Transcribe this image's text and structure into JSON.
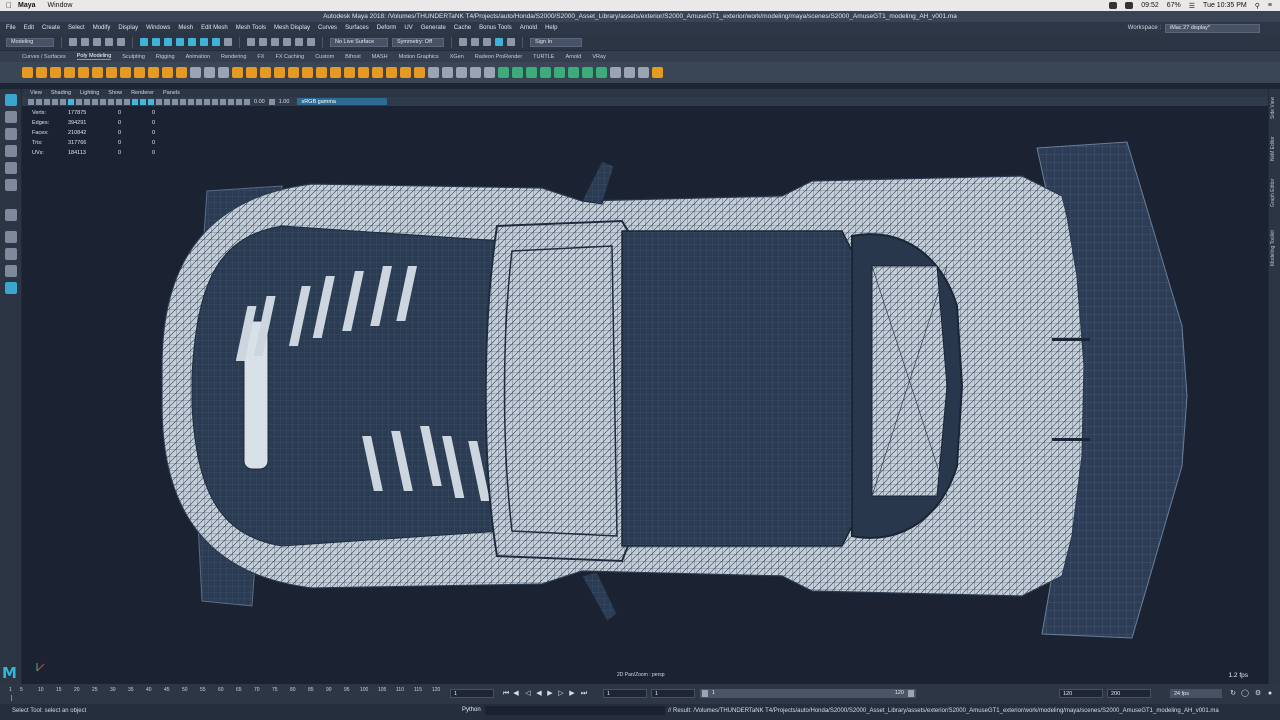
{
  "mac_menubar": {
    "app": "Maya",
    "menus": [
      "Window"
    ],
    "battery": "67%",
    "clock": "Tue 10:35 PM",
    "time_small": "09:52"
  },
  "window": {
    "title": "Autodesk Maya 2018: /Volumes/THUNDERTaNK T4/Projects/auto/Honda/S2000/S2000_Asset_Library/assets/exterior/S2000_AmuseGT1_exterior/work/modeling/maya/scenes/S2000_AmuseGT1_modeling_AH_v001.ma"
  },
  "main_menu": {
    "items": [
      "File",
      "Edit",
      "Create",
      "Select",
      "Modify",
      "Display",
      "Windows",
      "Mesh",
      "Edit Mesh",
      "Mesh Tools",
      "Mesh Display",
      "Curves",
      "Surfaces",
      "Deform",
      "UV",
      "Generate",
      "Cache",
      "Bonus Tools",
      "Arnold",
      "Help"
    ],
    "workspace_label": "Workspace :",
    "workspace_value": "iMac 27 display*"
  },
  "status_line": {
    "mode": "Modeling",
    "live_surface": "No Live Surface",
    "symmetry": "Symmetry: Off",
    "sign_in": "Sign In"
  },
  "shelf_tabs": [
    "Curves / Surfaces",
    "Poly Modeling",
    "Sculpting",
    "Rigging",
    "Animation",
    "Rendering",
    "FX",
    "FX Caching",
    "Custom",
    "Bifrost",
    "MASH",
    "Motion Graphics",
    "XGen",
    "Radeon ProRender",
    "TURTLE",
    "Arnold",
    "VRay"
  ],
  "active_shelf": "Poly Modeling",
  "panel_menu": [
    "View",
    "Shading",
    "Lighting",
    "Show",
    "Renderer",
    "Panels"
  ],
  "panel_toolbar": {
    "exposure": "0.00",
    "gamma": "1.00",
    "color_space": "sRGB gamma"
  },
  "hud": {
    "rows": [
      {
        "label": "Verts:",
        "value": "177875",
        "sel": "0",
        "comp": "0"
      },
      {
        "label": "Edges:",
        "value": "394291",
        "sel": "0",
        "comp": "0"
      },
      {
        "label": "Faces:",
        "value": "210842",
        "sel": "0",
        "comp": "0"
      },
      {
        "label": "Tris:",
        "value": "317766",
        "sel": "0",
        "comp": "0"
      },
      {
        "label": "UVs:",
        "value": "184113",
        "sel": "0",
        "comp": "0"
      }
    ],
    "camera": "2D Pan/Zoom : persp",
    "fps": "1.2 fps"
  },
  "side_tabs": [
    "Side View",
    "NxM Editor",
    "Graph Editor",
    "Modeling Toolkit"
  ],
  "time_slider": {
    "ticks": [
      "1",
      "5",
      "10",
      "15",
      "20",
      "25",
      "30",
      "35",
      "40",
      "45",
      "50",
      "55",
      "60",
      "65",
      "70",
      "75",
      "80",
      "85",
      "90",
      "95",
      "100",
      "105",
      "110",
      "115",
      "120"
    ],
    "current_frame": "1",
    "range_start": "1",
    "range_start2": "1",
    "range_inner_start": "1",
    "range_inner_end": "120",
    "end1": "120",
    "end2": "200",
    "fps_setting": "24 fps"
  },
  "command_line": {
    "help": "Select Tool: select an object",
    "language": "Python",
    "result": "// Result: /Volumes/THUNDERTaNK T4/Projects/auto/Honda/S2000/S2000_Asset_Library/assets/exterior/S2000_AmuseGT1_exterior/work/modeling/maya/scenes/S2000_AmuseGT1_modeling_AH_v001.ma"
  },
  "colors": {
    "accent": "#3fb4d8",
    "viewport_bg": "#1b2232",
    "mesh_fill": "#c5d0da",
    "mesh_wire": "#2a3a50"
  }
}
